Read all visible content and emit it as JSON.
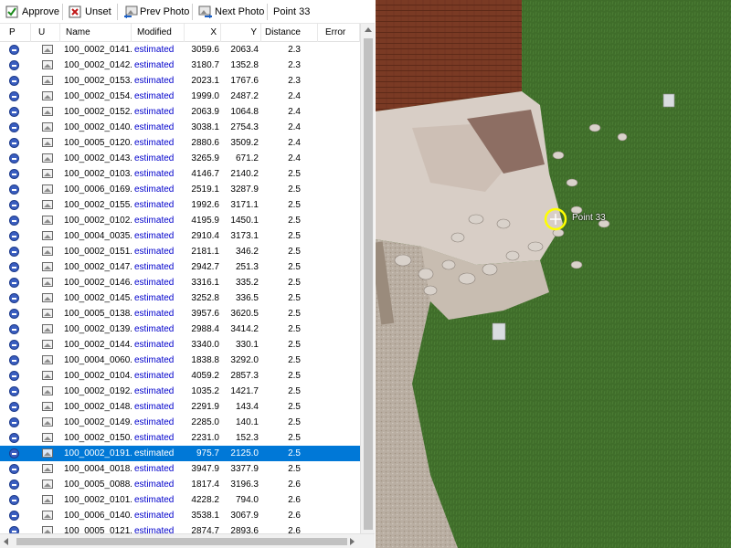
{
  "toolbar": {
    "approve_label": "Approve",
    "unset_label": "Unset",
    "prev_label": "Prev Photo",
    "next_label": "Next Photo",
    "point_label": "Point 33"
  },
  "columns": {
    "p": "P",
    "u": "U",
    "name": "Name",
    "modified": "Modified",
    "x": "X",
    "y": "Y",
    "distance": "Distance",
    "error": "Error"
  },
  "rows": [
    {
      "name": "100_0002_0141...",
      "modified": "estimated",
      "x": "3059.6",
      "y": "2063.4",
      "distance": "2.3"
    },
    {
      "name": "100_0002_0142...",
      "modified": "estimated",
      "x": "3180.7",
      "y": "1352.8",
      "distance": "2.3"
    },
    {
      "name": "100_0002_0153...",
      "modified": "estimated",
      "x": "2023.1",
      "y": "1767.6",
      "distance": "2.3"
    },
    {
      "name": "100_0002_0154...",
      "modified": "estimated",
      "x": "1999.0",
      "y": "2487.2",
      "distance": "2.4"
    },
    {
      "name": "100_0002_0152...",
      "modified": "estimated",
      "x": "2063.9",
      "y": "1064.8",
      "distance": "2.4"
    },
    {
      "name": "100_0002_0140...",
      "modified": "estimated",
      "x": "3038.1",
      "y": "2754.3",
      "distance": "2.4"
    },
    {
      "name": "100_0005_0120...",
      "modified": "estimated",
      "x": "2880.6",
      "y": "3509.2",
      "distance": "2.4"
    },
    {
      "name": "100_0002_0143...",
      "modified": "estimated",
      "x": "3265.9",
      "y": "671.2",
      "distance": "2.4"
    },
    {
      "name": "100_0002_0103...",
      "modified": "estimated",
      "x": "4146.7",
      "y": "2140.2",
      "distance": "2.5"
    },
    {
      "name": "100_0006_0169...",
      "modified": "estimated",
      "x": "2519.1",
      "y": "3287.9",
      "distance": "2.5"
    },
    {
      "name": "100_0002_0155...",
      "modified": "estimated",
      "x": "1992.6",
      "y": "3171.1",
      "distance": "2.5"
    },
    {
      "name": "100_0002_0102...",
      "modified": "estimated",
      "x": "4195.9",
      "y": "1450.1",
      "distance": "2.5"
    },
    {
      "name": "100_0004_0035...",
      "modified": "estimated",
      "x": "2910.4",
      "y": "3173.1",
      "distance": "2.5"
    },
    {
      "name": "100_0002_0151...",
      "modified": "estimated",
      "x": "2181.1",
      "y": "346.2",
      "distance": "2.5"
    },
    {
      "name": "100_0002_0147...",
      "modified": "estimated",
      "x": "2942.7",
      "y": "251.3",
      "distance": "2.5"
    },
    {
      "name": "100_0002_0146...",
      "modified": "estimated",
      "x": "3316.1",
      "y": "335.2",
      "distance": "2.5"
    },
    {
      "name": "100_0002_0145...",
      "modified": "estimated",
      "x": "3252.8",
      "y": "336.5",
      "distance": "2.5"
    },
    {
      "name": "100_0005_0138...",
      "modified": "estimated",
      "x": "3957.6",
      "y": "3620.5",
      "distance": "2.5"
    },
    {
      "name": "100_0002_0139...",
      "modified": "estimated",
      "x": "2988.4",
      "y": "3414.2",
      "distance": "2.5"
    },
    {
      "name": "100_0002_0144...",
      "modified": "estimated",
      "x": "3340.0",
      "y": "330.1",
      "distance": "2.5"
    },
    {
      "name": "100_0004_0060...",
      "modified": "estimated",
      "x": "1838.8",
      "y": "3292.0",
      "distance": "2.5"
    },
    {
      "name": "100_0002_0104...",
      "modified": "estimated",
      "x": "4059.2",
      "y": "2857.3",
      "distance": "2.5"
    },
    {
      "name": "100_0002_0192...",
      "modified": "estimated",
      "x": "1035.2",
      "y": "1421.7",
      "distance": "2.5"
    },
    {
      "name": "100_0002_0148...",
      "modified": "estimated",
      "x": "2291.9",
      "y": "143.4",
      "distance": "2.5"
    },
    {
      "name": "100_0002_0149...",
      "modified": "estimated",
      "x": "2285.0",
      "y": "140.1",
      "distance": "2.5"
    },
    {
      "name": "100_0002_0150...",
      "modified": "estimated",
      "x": "2231.0",
      "y": "152.3",
      "distance": "2.5"
    },
    {
      "name": "100_0002_0191...",
      "modified": "estimated",
      "x": "975.7",
      "y": "2125.0",
      "distance": "2.5",
      "selected": true
    },
    {
      "name": "100_0004_0018...",
      "modified": "estimated",
      "x": "3947.9",
      "y": "3377.9",
      "distance": "2.5"
    },
    {
      "name": "100_0005_0088...",
      "modified": "estimated",
      "x": "1817.4",
      "y": "3196.3",
      "distance": "2.6"
    },
    {
      "name": "100_0002_0101...",
      "modified": "estimated",
      "x": "4228.2",
      "y": "794.0",
      "distance": "2.6"
    },
    {
      "name": "100_0006_0140...",
      "modified": "estimated",
      "x": "3538.1",
      "y": "3067.9",
      "distance": "2.6"
    },
    {
      "name": "100_0005_0121...",
      "modified": "estimated",
      "x": "2874.7",
      "y": "2893.6",
      "distance": "2.6"
    }
  ],
  "photo": {
    "marker_label": "Point 33",
    "marker_color": "#ffff00"
  },
  "colors": {
    "selection": "#0078d7",
    "modified_text": "#0000cc",
    "grass": "#3f6d2a",
    "roof": "#7a3a24"
  }
}
